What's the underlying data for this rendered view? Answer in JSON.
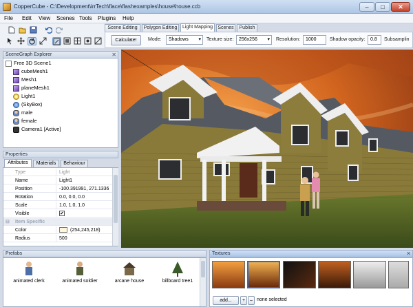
{
  "window": {
    "title": "CopperCube - C:\\Development\\irrTech\\flace\\flashexamples\\house\\house.ccb",
    "min": "–",
    "max": "□",
    "close": "✕"
  },
  "menu": [
    "File",
    "Edit",
    "View",
    "Scenes",
    "Tools",
    "Plugins",
    "Help"
  ],
  "toolbar": {
    "icons": [
      "new-file-icon",
      "open-folder-icon",
      "save-icon",
      "undo-icon",
      "redo-icon",
      "select-arrow-icon",
      "move-icon",
      "rotate-icon",
      "scale-icon",
      "view-mode-1-icon",
      "view-mode-2-icon",
      "view-mode-3-icon",
      "view-mode-4-icon",
      "view-mode-5-icon"
    ]
  },
  "editor_tabs": [
    {
      "label": "Scene Editing",
      "active": false
    },
    {
      "label": "Polygon Editing",
      "active": false
    },
    {
      "label": "Light Mapping",
      "active": true
    },
    {
      "label": "Scenes",
      "active": false
    },
    {
      "label": "Publish",
      "active": false
    }
  ],
  "lightmap": {
    "calculate_label": "Calculate!",
    "mode_label": "Mode:",
    "mode_value": "Shadows",
    "texsize_label": "Texture size:",
    "texsize_value": "256x256",
    "resolution_label": "Resolution:",
    "resolution_value": "1000",
    "opacity_label": "Shadow opacity:",
    "opacity_value": "0.8",
    "subsampling_label": "Subsamplin"
  },
  "scenegraph": {
    "title": "SceneGraph Explorer",
    "items": [
      {
        "label": "Free 3D Scene1",
        "icon": "scene-root-icon",
        "indent": 0
      },
      {
        "label": "cubeMesh1",
        "icon": "mesh-icon",
        "indent": 1
      },
      {
        "label": "Mesh1",
        "icon": "mesh-icon",
        "indent": 1
      },
      {
        "label": "planeMesh1",
        "icon": "mesh-icon",
        "indent": 1
      },
      {
        "label": "Light1",
        "icon": "light-bulb-icon",
        "indent": 1
      },
      {
        "label": "(SkyBox)",
        "icon": "skybox-icon",
        "indent": 1
      },
      {
        "label": "male",
        "icon": "character-icon",
        "indent": 1
      },
      {
        "label": "female",
        "icon": "character-icon",
        "indent": 1
      },
      {
        "label": "Camera1 [Active]",
        "icon": "camera-icon",
        "indent": 1
      }
    ]
  },
  "properties": {
    "title": "Properties",
    "tabs": [
      "Attributes",
      "Materials",
      "Behaviour"
    ],
    "rows": [
      {
        "key": "Type",
        "value": "Light",
        "muted": true
      },
      {
        "key": "Name",
        "value": "Light1"
      },
      {
        "key": "Position",
        "value": "-100.391991, 271.1336"
      },
      {
        "key": "Rotation",
        "value": "0.0, 0.0, 0.0"
      },
      {
        "key": "Scale",
        "value": "1.0, 1.0, 1.0"
      },
      {
        "key": "Visible",
        "value": "✔",
        "checkbox": true
      },
      {
        "key": "Item Specific",
        "value": "",
        "section": true
      },
      {
        "key": "Color",
        "value": "(254,245,218)",
        "color": "#fef5da"
      },
      {
        "key": "Radius",
        "value": "500"
      }
    ]
  },
  "prefabs": {
    "title": "Prefabs",
    "items": [
      {
        "label": "animated clerk"
      },
      {
        "label": "animated soldier"
      },
      {
        "label": "arcane house"
      },
      {
        "label": "billboard tree1"
      }
    ]
  },
  "textures": {
    "title": "Textures",
    "add_label": "add...",
    "status": "none selected",
    "plus": "+",
    "minus": "–"
  }
}
